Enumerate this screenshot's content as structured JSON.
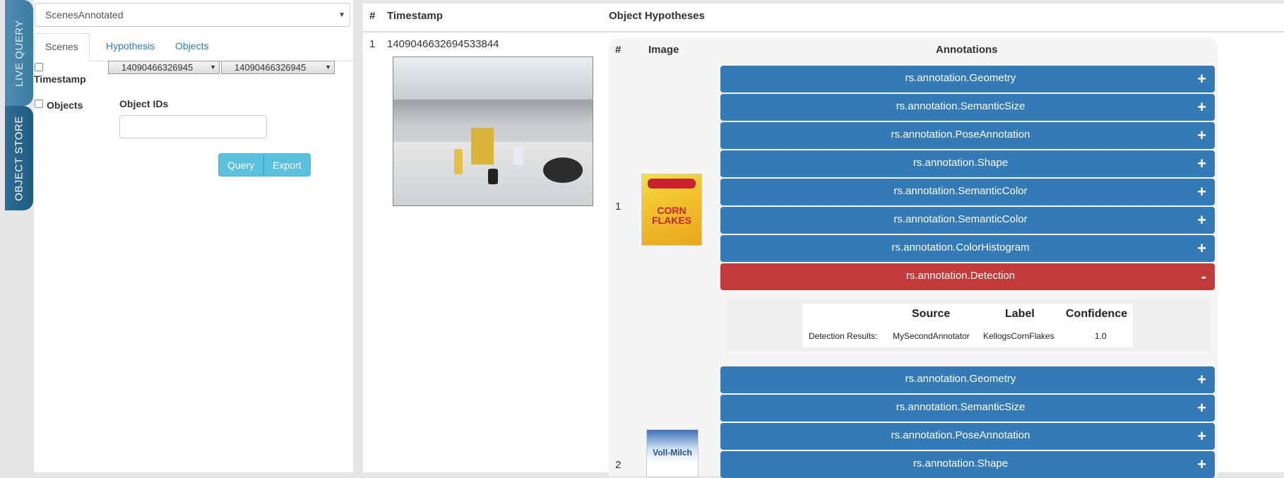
{
  "side_tabs": {
    "live": "LIVE QUERY",
    "store": "OBJECT STORE"
  },
  "left": {
    "db_select": "ScenesAnnotated",
    "tabs": [
      "Scenes",
      "Hypothesis",
      "Objects"
    ],
    "timestamp_label": "Timestamp",
    "from_ts": "14090466326945",
    "to_ts": "14090466326945",
    "objects_label": "Objects",
    "object_ids_label": "Object IDs",
    "object_ids_value": "",
    "query_button": "Query",
    "export_button": "Export"
  },
  "results": {
    "headers": {
      "num": "#",
      "timestamp": "Timestamp",
      "hypotheses": "Object Hypotheses"
    },
    "row": {
      "num": "1",
      "timestamp": "1409046632694533844"
    },
    "hyp_headers": {
      "num": "#",
      "image": "Image",
      "annotations": "Annotations"
    },
    "hyp1": {
      "num": "1",
      "thumb_text": "CORN FLAKES",
      "annotations": [
        {
          "label": "rs.annotation.Geometry",
          "sign": "+"
        },
        {
          "label": "rs.annotation.SemanticSize",
          "sign": "+"
        },
        {
          "label": "rs.annotation.PoseAnnotation",
          "sign": "+"
        },
        {
          "label": "rs.annotation.Shape",
          "sign": "+"
        },
        {
          "label": "rs.annotation.SemanticColor",
          "sign": "+"
        },
        {
          "label": "rs.annotation.SemanticColor",
          "sign": "+"
        },
        {
          "label": "rs.annotation.ColorHistogram",
          "sign": "+"
        },
        {
          "label": "rs.annotation.Detection",
          "sign": "-"
        }
      ],
      "detection": {
        "headers": [
          "Source",
          "Label",
          "Confidence"
        ],
        "row_label": "Detection Results:",
        "source": "MySecondAnnotator",
        "label": "KellogsCornFlakes",
        "confidence": "1.0"
      }
    },
    "hyp2": {
      "num": "2",
      "thumb_text": "Voll-Milch",
      "annotations": [
        {
          "label": "rs.annotation.Geometry",
          "sign": "+"
        },
        {
          "label": "rs.annotation.SemanticSize",
          "sign": "+"
        },
        {
          "label": "rs.annotation.PoseAnnotation",
          "sign": "+"
        },
        {
          "label": "rs.annotation.Shape",
          "sign": "+"
        }
      ]
    }
  },
  "colors": {
    "primary": "#337ab7",
    "danger": "#c23b3b",
    "info": "#5bc0de",
    "side_tab": "#2f6d93"
  }
}
